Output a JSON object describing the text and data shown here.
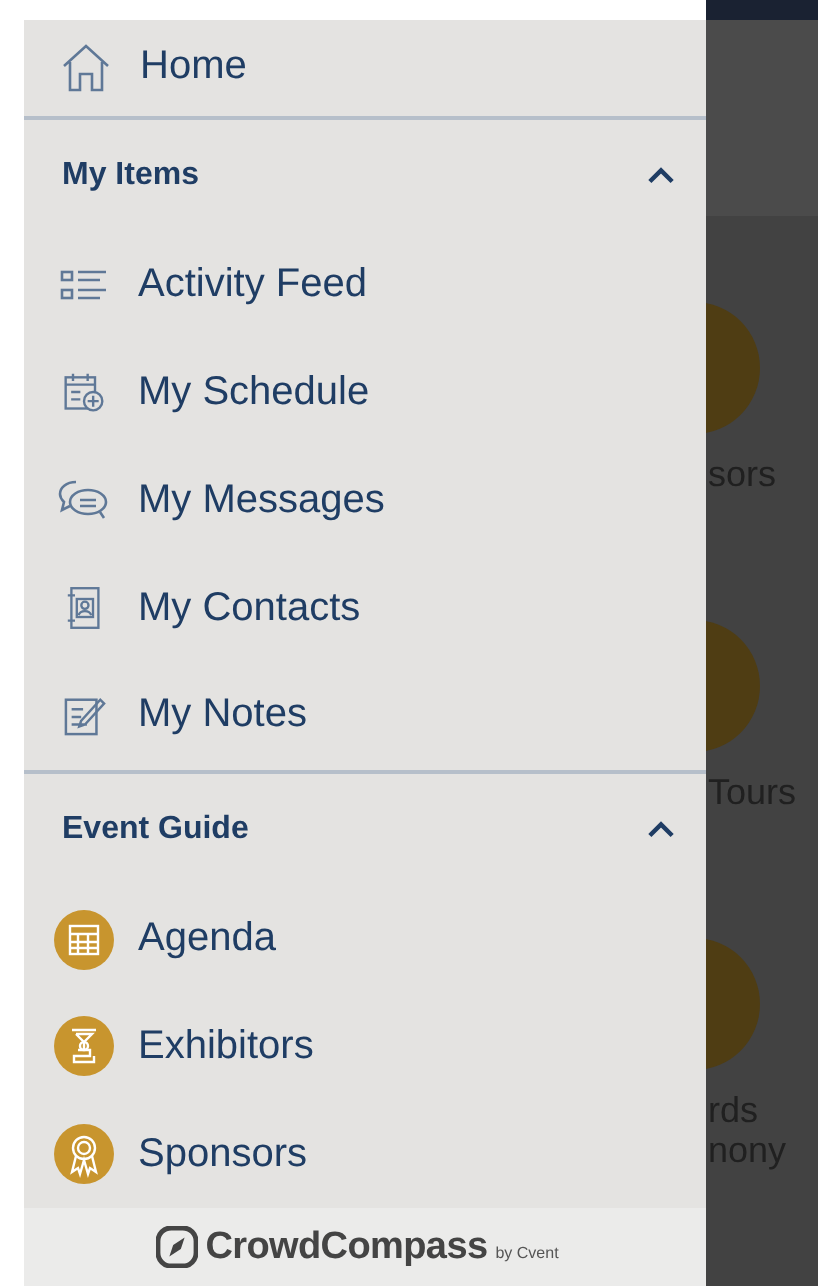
{
  "home": {
    "label": "Home"
  },
  "sections": [
    {
      "title": "My Items",
      "expanded": true,
      "items": [
        {
          "label": "Activity Feed",
          "kind": "feed"
        },
        {
          "label": "My Schedule",
          "kind": "schedule"
        },
        {
          "label": "My Messages",
          "kind": "messages"
        },
        {
          "label": "My Contacts",
          "kind": "contacts"
        },
        {
          "label": "My Notes",
          "kind": "notes"
        }
      ]
    },
    {
      "title": "Event Guide",
      "expanded": true,
      "items": [
        {
          "label": "Agenda",
          "kind": "agenda"
        },
        {
          "label": "Exhibitors",
          "kind": "exhibitors"
        },
        {
          "label": "Sponsors",
          "kind": "sponsors"
        }
      ]
    }
  ],
  "footer": {
    "brand": "CrowdCompass",
    "byline": "by Cvent"
  },
  "background_tiles": [
    {
      "lines": [
        "sors"
      ]
    },
    {
      "lines": [
        "Tours"
      ]
    },
    {
      "lines": [
        "rds",
        "nony"
      ]
    }
  ]
}
